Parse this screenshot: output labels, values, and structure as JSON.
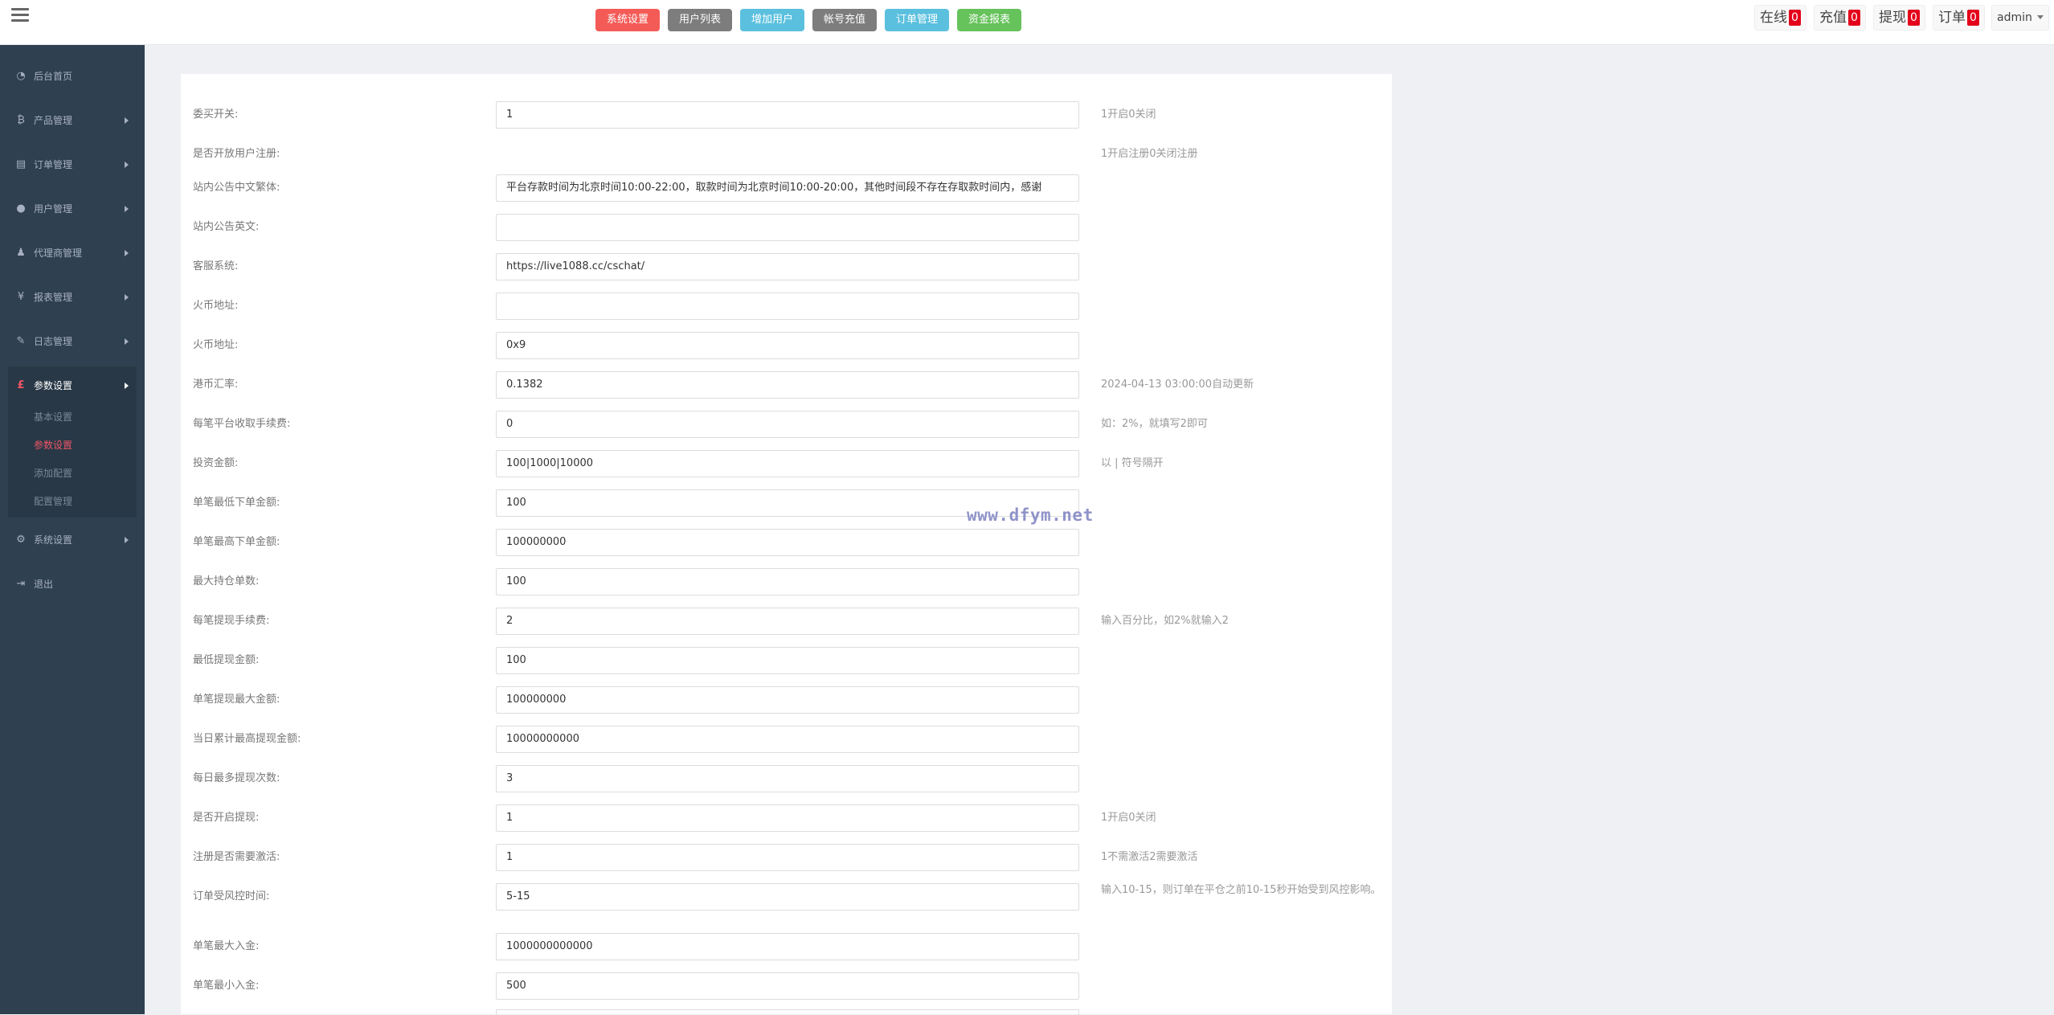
{
  "topbar": {
    "menu_icon": "hamburger-menu-icon",
    "quick_buttons": [
      {
        "label": "系统设置",
        "color": "#f45b57"
      },
      {
        "label": "用户列表",
        "color": "#7d7d7d"
      },
      {
        "label": "增加用户",
        "color": "#5bc0de"
      },
      {
        "label": "帐号充值",
        "color": "#7d7d7d"
      },
      {
        "label": "订单管理",
        "color": "#5bc0de"
      },
      {
        "label": "资金报表",
        "color": "#66c25b"
      }
    ],
    "stats": [
      {
        "label": "在线",
        "count": "0"
      },
      {
        "label": "充值",
        "count": "0"
      },
      {
        "label": "提现",
        "count": "0"
      },
      {
        "label": "订单",
        "count": "0"
      }
    ],
    "admin_label": "admin"
  },
  "sidebar": {
    "items": [
      {
        "label": "后台首页",
        "icon": "dashboard-icon"
      },
      {
        "label": "产品管理",
        "icon": "bitcoin-icon"
      },
      {
        "label": "订单管理",
        "icon": "order-icon"
      },
      {
        "label": "用户管理",
        "icon": "user-icon"
      },
      {
        "label": "代理商管理",
        "icon": "agent-icon"
      },
      {
        "label": "报表管理",
        "icon": "yen-icon"
      },
      {
        "label": "日志管理",
        "icon": "log-icon"
      },
      {
        "label": "参数设置",
        "icon": "pound-icon"
      },
      {
        "label": "系统设置",
        "icon": "gears-icon"
      },
      {
        "label": "退出",
        "icon": "sign-out-icon"
      }
    ],
    "sub_items": [
      "基本设置",
      "参数设置",
      "添加配置",
      "配置管理"
    ],
    "active_item": "参数设置",
    "current_sub_item": "参数设置"
  },
  "form": {
    "rows": [
      {
        "label": "委买开关:",
        "value": "1",
        "help": "1开启0关闭",
        "has_input": true
      },
      {
        "label": "是否开放用户注册:",
        "value": "",
        "help": "1开启注册0关闭注册",
        "has_input": false
      },
      {
        "label": "站内公告中文繁体:",
        "value": "平台存款时间为北京时间10:00-22:00，取款时间为北京时间10:00-20:00，其他时间段不存在存取款时间内，感谢",
        "help": "",
        "has_input": true
      },
      {
        "label": "站内公告英文:",
        "value": "",
        "help": "",
        "has_input": true
      },
      {
        "label": "客服系统:",
        "value": "https://live1088.cc/cschat/",
        "help": "",
        "has_input": true
      },
      {
        "label": "火币地址:",
        "value": "",
        "help": "",
        "has_input": true
      },
      {
        "label": "火币地址:",
        "value": "0x9",
        "help": "",
        "has_input": true
      },
      {
        "label": "港币汇率:",
        "value": "0.1382",
        "help": "2024-04-13 03:00:00自动更新",
        "has_input": true
      },
      {
        "label": "每笔平台收取手续费:",
        "value": "0",
        "help": "如：2%，就填写2即可",
        "has_input": true
      },
      {
        "label": "投资金额:",
        "value": "100|1000|10000",
        "help": "以 | 符号隔开",
        "has_input": true
      },
      {
        "label": "单笔最低下单金额:",
        "value": "100",
        "help": "",
        "has_input": true
      },
      {
        "label": "单笔最高下单金额:",
        "value": "100000000",
        "help": "",
        "has_input": true
      },
      {
        "label": "最大持仓单数:",
        "value": "100",
        "help": "",
        "has_input": true
      },
      {
        "label": "每笔提现手续费:",
        "value": "2",
        "help": "输入百分比，如2%就输入2",
        "has_input": true
      },
      {
        "label": "最低提现金额:",
        "value": "100",
        "help": "",
        "has_input": true
      },
      {
        "label": "单笔提现最大金额:",
        "value": "100000000",
        "help": "",
        "has_input": true
      },
      {
        "label": "当日累计最高提现金额:",
        "value": "10000000000",
        "help": "",
        "has_input": true
      },
      {
        "label": "每日最多提现次数:",
        "value": "3",
        "help": "",
        "has_input": true
      },
      {
        "label": "是否开启提现:",
        "value": "1",
        "help": "1开启0关闭",
        "has_input": true
      },
      {
        "label": "注册是否需要激活:",
        "value": "1",
        "help": "1不需激活2需要激活",
        "has_input": true
      },
      {
        "label": "订单受风控时间:",
        "value": "5-15",
        "help": "输入10-15，则订单在平仓之前10-15秒开始受到风控影响。",
        "has_input": true
      },
      {
        "label": "单笔最大入金:",
        "value": "1000000000000",
        "help": "",
        "has_input": true
      },
      {
        "label": "单笔最小入金:",
        "value": "500",
        "help": "",
        "has_input": true
      }
    ]
  },
  "watermark": "www.dfym.net"
}
